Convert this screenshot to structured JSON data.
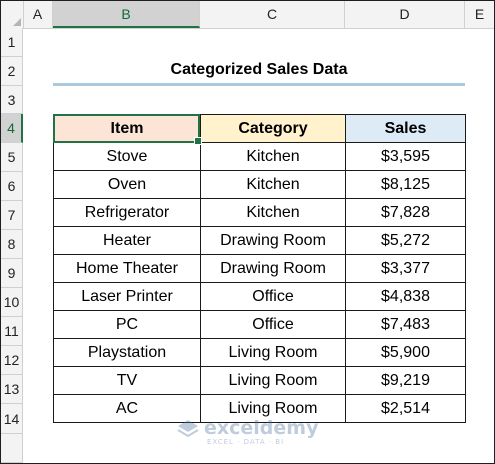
{
  "columns": [
    "A",
    "B",
    "C",
    "D",
    "E"
  ],
  "rows": [
    "1",
    "2",
    "3",
    "4",
    "5",
    "6",
    "7",
    "8",
    "9",
    "10",
    "11",
    "12",
    "13",
    "14"
  ],
  "title": "Categorized Sales Data",
  "table": {
    "headers": [
      "Item",
      "Category",
      "Sales"
    ],
    "rows": [
      [
        "Stove",
        "Kitchen",
        "$3,595"
      ],
      [
        "Oven",
        "Kitchen",
        "$8,125"
      ],
      [
        "Refrigerator",
        "Kitchen",
        "$7,828"
      ],
      [
        "Heater",
        "Drawing Room",
        "$5,272"
      ],
      [
        "Home Theater",
        "Drawing Room",
        "$3,377"
      ],
      [
        "Laser Printer",
        "Office",
        "$4,838"
      ],
      [
        "PC",
        "Office",
        "$7,483"
      ],
      [
        "Playstation",
        "Living Room",
        "$5,900"
      ],
      [
        "TV",
        "Living Room",
        "$9,219"
      ],
      [
        "AC",
        "Living Room",
        "$2,514"
      ]
    ]
  },
  "active_cell": {
    "column": "B",
    "row": "4"
  },
  "colors": {
    "selection": "#217346",
    "item_header_fill": "#fce4d6",
    "category_header_fill": "#fff2cc",
    "sales_header_fill": "#ddebf7",
    "title_underline": "#a9c9de"
  },
  "watermark": {
    "name": "exceldemy",
    "tagline": "EXCEL · DATA · BI",
    "icon": "exceldemy-logo-icon"
  }
}
